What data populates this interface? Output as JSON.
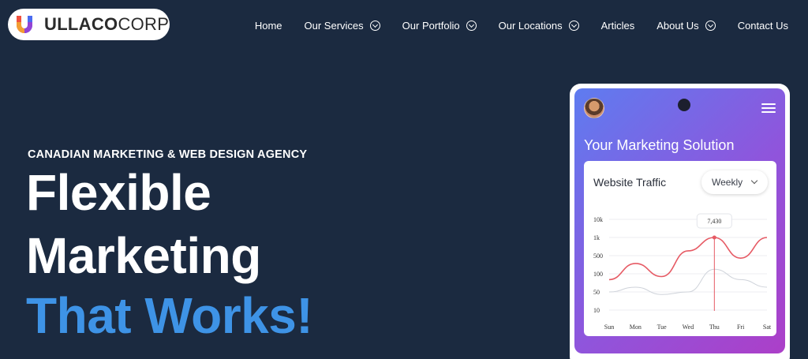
{
  "brand": {
    "name_bold": "ULLACO",
    "name_light": "CORP"
  },
  "nav": [
    {
      "label": "Home",
      "dropdown": false
    },
    {
      "label": "Our Services",
      "dropdown": true
    },
    {
      "label": "Our Portfolio",
      "dropdown": true
    },
    {
      "label": "Our Locations",
      "dropdown": true
    },
    {
      "label": "Articles",
      "dropdown": false
    },
    {
      "label": "About Us",
      "dropdown": true
    },
    {
      "label": "Contact Us",
      "dropdown": false
    }
  ],
  "hero": {
    "eyebrow": "CANADIAN MARKETING & WEB DESIGN AGENCY",
    "line1": "Flexible",
    "line2": "Marketing",
    "line3": "That Works!"
  },
  "phone": {
    "title": "Your Marketing Solution",
    "card_title": "Website Traffic",
    "period": "Weekly"
  },
  "colors": {
    "background": "#1b2a40",
    "accent": "#3e93e6",
    "series": "#e65a64",
    "series2": "#cfd3da"
  },
  "chart_data": {
    "type": "line",
    "categories": [
      "Sun",
      "Mon",
      "Tue",
      "Wed",
      "Thu",
      "Fri",
      "Sat"
    ],
    "y_ticks": [
      "10k",
      "1k",
      "500",
      "100",
      "50",
      "10"
    ],
    "yscale": "log",
    "series": [
      {
        "values": [
          80,
          250,
          90,
          600,
          1000,
          400,
          1000
        ]
      },
      {
        "values": [
          50,
          60,
          40,
          50,
          150,
          80,
          60
        ]
      }
    ],
    "annotation": {
      "category": "Thu",
      "label": "7,430"
    },
    "grid": true,
    "legend": "none"
  }
}
